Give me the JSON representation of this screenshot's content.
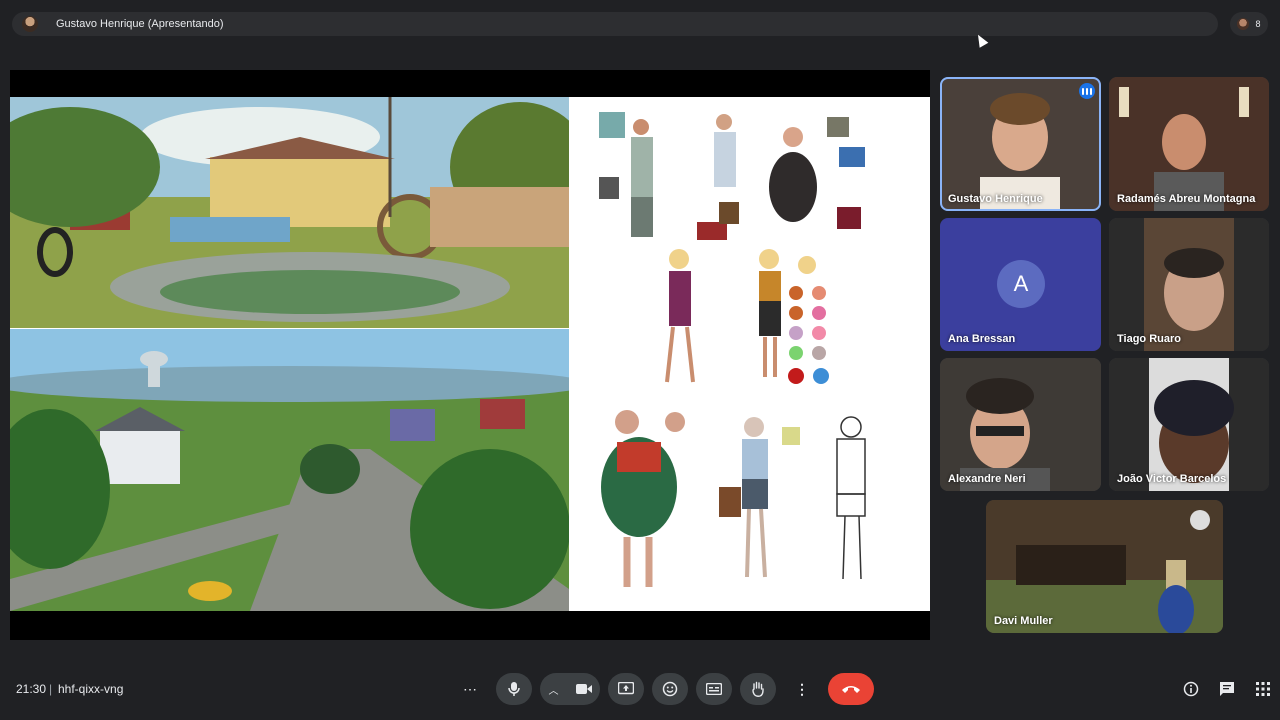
{
  "presenter_bar": {
    "label": "Gustavo Henrique (Apresentando)"
  },
  "participants_count": "8",
  "participants": [
    {
      "name": "Gustavo Henrique",
      "speaking": true
    },
    {
      "name": "Radamés Abreu Montagna"
    },
    {
      "name": "Ana Bressan",
      "avatar_letter": "A"
    },
    {
      "name": "Tiago Ruaro"
    },
    {
      "name": "Alexandre Neri"
    },
    {
      "name": "João Victor Barcelos"
    },
    {
      "name": "Davi Muller"
    }
  ],
  "bottom_bar": {
    "time": "21:30",
    "separator": "|",
    "meeting_code": "hhf-qixx-vng"
  },
  "controls": [
    "more-options",
    "microphone",
    "camera",
    "present-screen",
    "reactions",
    "captions",
    "raise-hand",
    "more-actions",
    "leave-call"
  ],
  "right_tools": [
    "meeting-info",
    "chat",
    "activities"
  ],
  "colors": {
    "background": "#202124",
    "leave": "#ea4335",
    "active_outline": "#8ab4f8",
    "avatar": "#5c6bc0"
  }
}
